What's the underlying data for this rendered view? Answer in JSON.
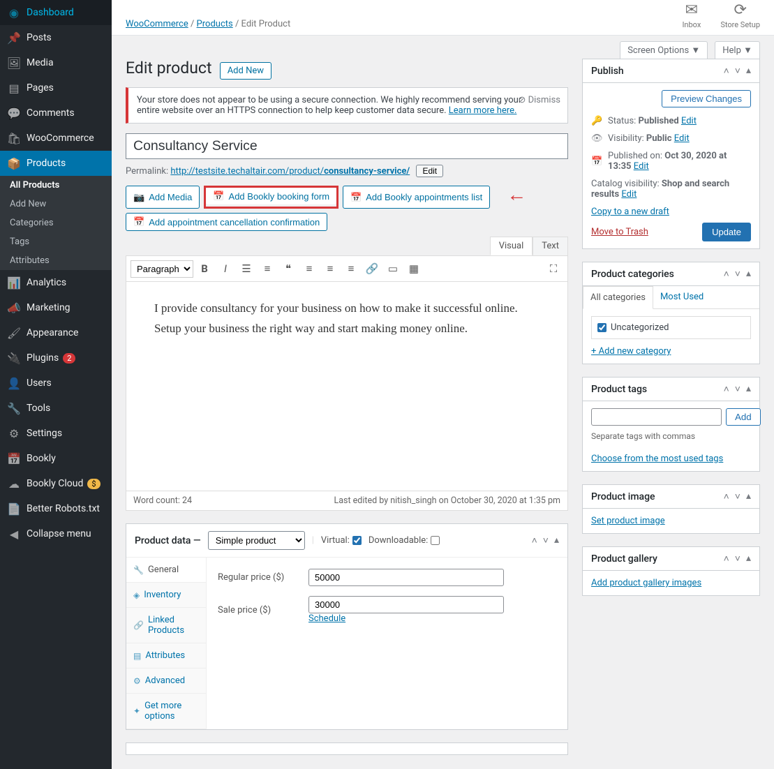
{
  "breadcrumb": {
    "woo": "WooCommerce",
    "products": "Products",
    "current": "Edit Product"
  },
  "topbar": {
    "inbox": "Inbox",
    "store_setup": "Store Setup"
  },
  "screen_options": "Screen Options ▼",
  "help": "Help ▼",
  "page_title": "Edit product",
  "add_new": "Add New",
  "notice": {
    "text": "Your store does not appear to be using a secure connection. We highly recommend serving your entire website over an HTTPS connection to help keep customer data secure. ",
    "link": "Learn more here.",
    "dismiss": "Dismiss"
  },
  "title_value": "Consultancy Service",
  "permalink": {
    "label": "Permalink: ",
    "base": "http://testsite.techaltair.com/product/",
    "slug": "consultancy-service/",
    "edit": "Edit"
  },
  "media_buttons": {
    "add_media": "Add Media",
    "add_bookly_form": "Add Bookly booking form",
    "add_bookly_appts": "Add Bookly appointments list",
    "add_cancel_confirm": "Add appointment cancellation confirmation"
  },
  "editor": {
    "tabs": {
      "visual": "Visual",
      "text": "Text"
    },
    "format": "Paragraph",
    "content": "I provide consultancy for your business on how to make it successful online. Setup your business the right way and start making money online.",
    "word_count_label": "Word count: ",
    "word_count": "24",
    "last_edited": "Last edited by nitish_singh on October 30, 2020 at 1:35 pm"
  },
  "product_data": {
    "header": "Product data —",
    "type": "Simple product",
    "virtual_label": "Virtual:",
    "virtual": true,
    "downloadable_label": "Downloadable:",
    "downloadable": false,
    "tabs": {
      "general": "General",
      "inventory": "Inventory",
      "linked": "Linked Products",
      "attributes": "Attributes",
      "advanced": "Advanced",
      "get_more": "Get more options"
    },
    "regular_price_label": "Regular price ($)",
    "regular_price": "50000",
    "sale_price_label": "Sale price ($)",
    "sale_price": "30000",
    "schedule": "Schedule"
  },
  "publish": {
    "title": "Publish",
    "preview": "Preview Changes",
    "status_label": "Status: ",
    "status_value": "Published",
    "status_edit": "Edit",
    "visibility_label": "Visibility: ",
    "visibility_value": "Public",
    "visibility_edit": "Edit",
    "published_label": "Published on: ",
    "published_value": "Oct 30, 2020 at 13:35",
    "published_edit": "Edit",
    "catalog_label": "Catalog visibility: ",
    "catalog_value": "Shop and search results",
    "catalog_edit": "Edit",
    "copy_draft": "Copy to a new draft",
    "move_trash": "Move to Trash",
    "update": "Update"
  },
  "categories": {
    "title": "Product categories",
    "all": "All categories",
    "most_used": "Most Used",
    "uncategorized": "Uncategorized",
    "add_new": "+ Add new category"
  },
  "tags": {
    "title": "Product tags",
    "add": "Add",
    "help": "Separate tags with commas",
    "choose": "Choose from the most used tags"
  },
  "image": {
    "title": "Product image",
    "set": "Set product image"
  },
  "gallery": {
    "title": "Product gallery",
    "add": "Add product gallery images"
  },
  "sidebar": {
    "dashboard": "Dashboard",
    "posts": "Posts",
    "media": "Media",
    "pages": "Pages",
    "comments": "Comments",
    "woocommerce": "WooCommerce",
    "products": "Products",
    "all_products": "All Products",
    "add_new": "Add New",
    "cats": "Categories",
    "tags": "Tags",
    "attributes": "Attributes",
    "analytics": "Analytics",
    "marketing": "Marketing",
    "appearance": "Appearance",
    "plugins": "Plugins",
    "plugins_badge": "2",
    "users": "Users",
    "tools": "Tools",
    "settings": "Settings",
    "bookly": "Bookly",
    "bookly_cloud": "Bookly Cloud",
    "bookly_badge": "$",
    "better_robots": "Better Robots.txt",
    "collapse": "Collapse menu"
  }
}
